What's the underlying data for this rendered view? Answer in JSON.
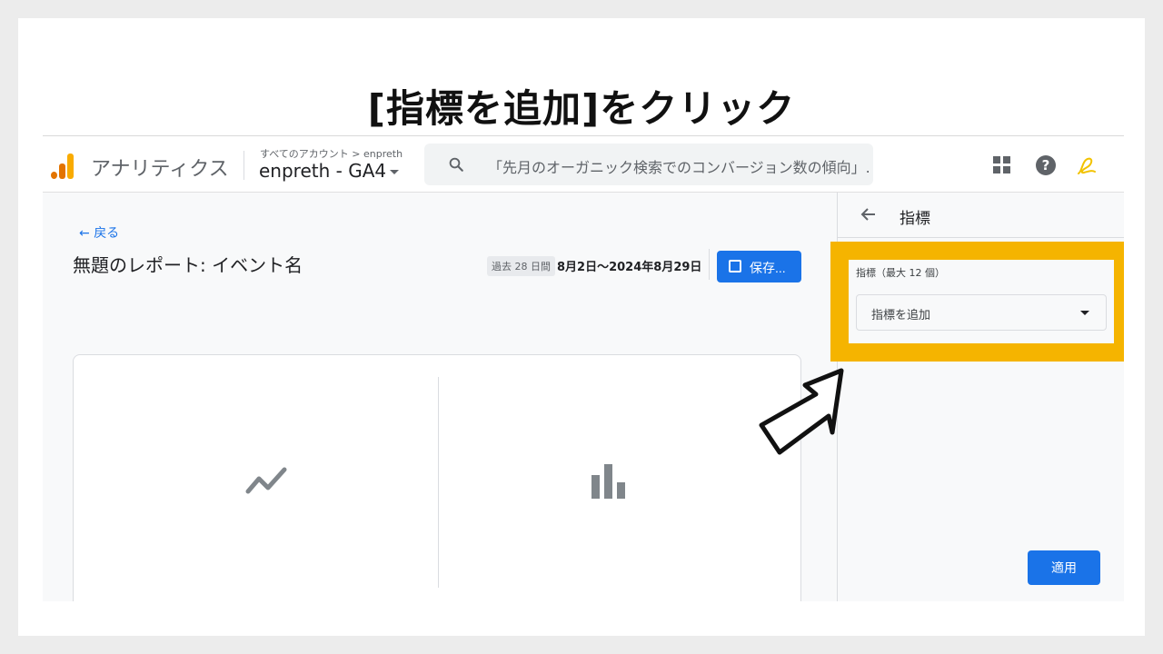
{
  "slide": {
    "title": "[指標を追加]をクリック"
  },
  "header": {
    "brand": "アナリティクス",
    "breadcrumb": "すべてのアカウント > enpreth",
    "account_name": "enpreth - GA4",
    "search_placeholder": "「先月のオーガニック検索でのコンバージョン数の傾向」..."
  },
  "main": {
    "back_label": "戻る",
    "report_title": "無題のレポート: イベント名",
    "date_chip": "過去 28 日間",
    "date_range": "8月2日～2024年8月29日",
    "save_label": "保存..."
  },
  "panel": {
    "title": "指標",
    "metric_label": "指標（最大 12 個）",
    "add_metric_label": "指標を追加",
    "apply_label": "適用"
  },
  "colors": {
    "highlight": "#f5b400",
    "primary_button": "#1a73e8"
  },
  "icons": [
    "ga-logo-icon",
    "search-icon",
    "apps-grid-icon",
    "help-icon",
    "user-avatar-icon",
    "back-arrow-icon",
    "save-icon",
    "line-chart-icon",
    "bar-chart-icon",
    "dropdown-caret-icon",
    "cursor-arrow-icon"
  ]
}
